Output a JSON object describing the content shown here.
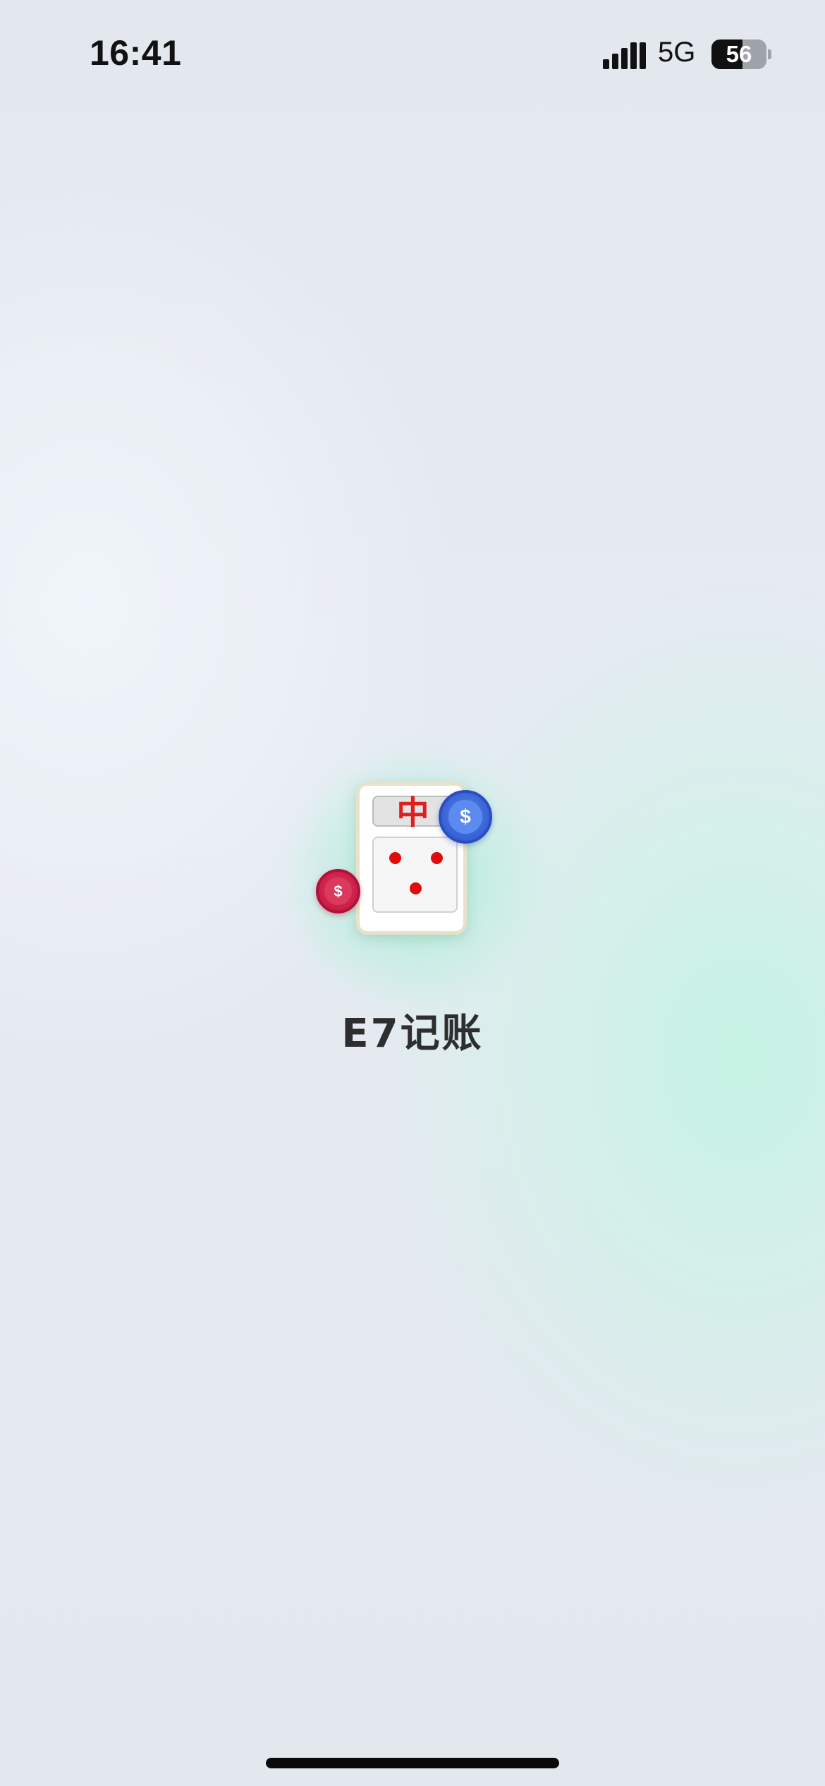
{
  "status_bar": {
    "time": "16:41",
    "network": "5G",
    "battery_percent": "56",
    "battery_level": 0.56,
    "icons": [
      "signal-bars-icon",
      "battery-icon"
    ]
  },
  "splash": {
    "logo": {
      "tile_character": "中",
      "blue_coin_symbol": "$",
      "red_coin_symbol": "$",
      "dice_dots": 3
    },
    "app_name": "E7记账"
  },
  "colors": {
    "tile_red": "#e11d1d",
    "coin_blue": "#3a66d8",
    "coin_red": "#c91e46",
    "background": "#e4e8f0",
    "accent_mint": "#c4f4e4"
  }
}
